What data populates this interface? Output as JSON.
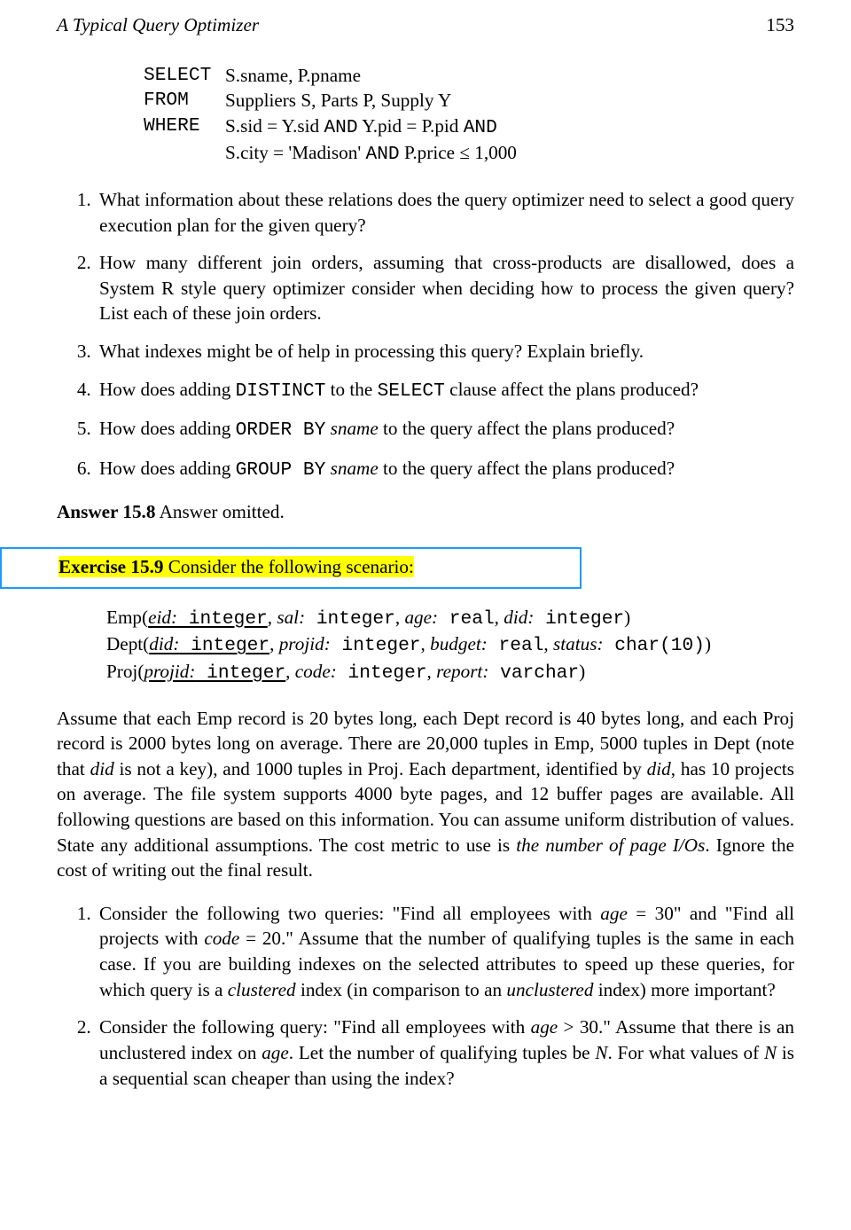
{
  "header": {
    "title": "A Typical Query Optimizer",
    "page_number": "153"
  },
  "sql": {
    "select_kw": "SELECT",
    "select_v": "S.sname, P.pname",
    "from_kw": "FROM",
    "from_v": "Suppliers S, Parts P, Supply Y",
    "where_kw": "WHERE",
    "where_1a": "S.sid = Y.sid ",
    "where_and1": "AND",
    "where_1b": " Y.pid = P.pid ",
    "where_and2": "AND",
    "where_2a": "S.city = 'Madison' ",
    "where_and3": "AND",
    "where_2b": " P.price ≤ 1,000"
  },
  "q1": "What information about these relations does the query optimizer need to select a good query execution plan for the given query?",
  "q2": "How many different join orders, assuming that cross-products are disallowed, does a System R style query optimizer consider when deciding how to process the given query? List each of these join orders.",
  "q3": "What indexes might be of help in processing this query? Explain briefly.",
  "q4a": "How does adding ",
  "q4b": "DISTINCT",
  "q4c": " to the ",
  "q4d": "SELECT",
  "q4e": " clause affect the plans produced?",
  "q5a": "How does adding ",
  "q5b": "ORDER BY",
  "q5c": " ",
  "q5d": "sname",
  "q5e": " to the query affect the plans produced?",
  "q6a": "How does adding ",
  "q6b": "GROUP BY",
  "q6c": " ",
  "q6d": "sname",
  "q6e": " to the query affect the plans produced?",
  "answer": {
    "label": "Answer 15.8",
    "text": " Answer omitted."
  },
  "exercise": {
    "label": "Exercise 15.9",
    "text": " Consider the following scenario:"
  },
  "schema": {
    "emp_a": "Emp(",
    "emp_b": "eid:",
    "emp_c": " integer",
    "emp_d": ", ",
    "emp_e": "sal:",
    "emp_f": " integer",
    "emp_g": ", ",
    "emp_h": "age:",
    "emp_i": " real",
    "emp_j": ", ",
    "emp_k": "did:",
    "emp_l": " integer",
    "emp_m": ")",
    "dept_a": "Dept(",
    "dept_b": "did:",
    "dept_c": " integer",
    "dept_d": ", ",
    "dept_e": "projid:",
    "dept_f": " integer",
    "dept_g": ", ",
    "dept_h": "budget:",
    "dept_i": " real",
    "dept_j": ", ",
    "dept_k": "status:",
    "dept_l": " char(10)",
    "dept_m": ")",
    "proj_a": "Proj(",
    "proj_b": "projid:",
    "proj_c": " integer",
    "proj_d": ", ",
    "proj_e": "code:",
    "proj_f": " integer",
    "proj_g": ", ",
    "proj_h": "report:",
    "proj_i": " varchar",
    "proj_j": ")"
  },
  "para1a": "Assume that each Emp record is 20 bytes long, each Dept record is 40 bytes long, and each Proj record is 2000 bytes long on average. There are 20,000 tuples in Emp, 5000 tuples in Dept (note that ",
  "para1b": "did",
  "para1c": " is not a key), and 1000 tuples in Proj. Each department, identified by ",
  "para1d": "did",
  "para1e": ", has 10 projects on average. The file system supports 4000 byte pages, and 12 buffer pages are available. All following questions are based on this information. You can assume uniform distribution of values. State any additional assumptions. The cost metric to use is ",
  "para1f": "the number of page I/Os",
  "para1g": ". Ignore the cost of writing out the final result.",
  "b1a": "Consider the following two queries: \"Find all employees with ",
  "b1b": "age",
  "b1c": " = 30\" and \"Find all projects with ",
  "b1d": "code",
  "b1e": " = 20.\" Assume that the number of qualifying tuples is the same in each case. If you are building indexes on the selected attributes to speed up these queries, for which query is a ",
  "b1f": "clustered",
  "b1g": " index (in comparison to an ",
  "b1h": "unclustered",
  "b1i": " index) more important?",
  "b2a": "Consider the following query: \"Find all employees with ",
  "b2b": "age",
  "b2c": " > 30.\" Assume that there is an unclustered index on ",
  "b2d": "age",
  "b2e": ". Let the number of qualifying tuples be ",
  "b2f": "N",
  "b2g": ". For what values of ",
  "b2h": "N",
  "b2i": " is a sequential scan cheaper than using the index?"
}
